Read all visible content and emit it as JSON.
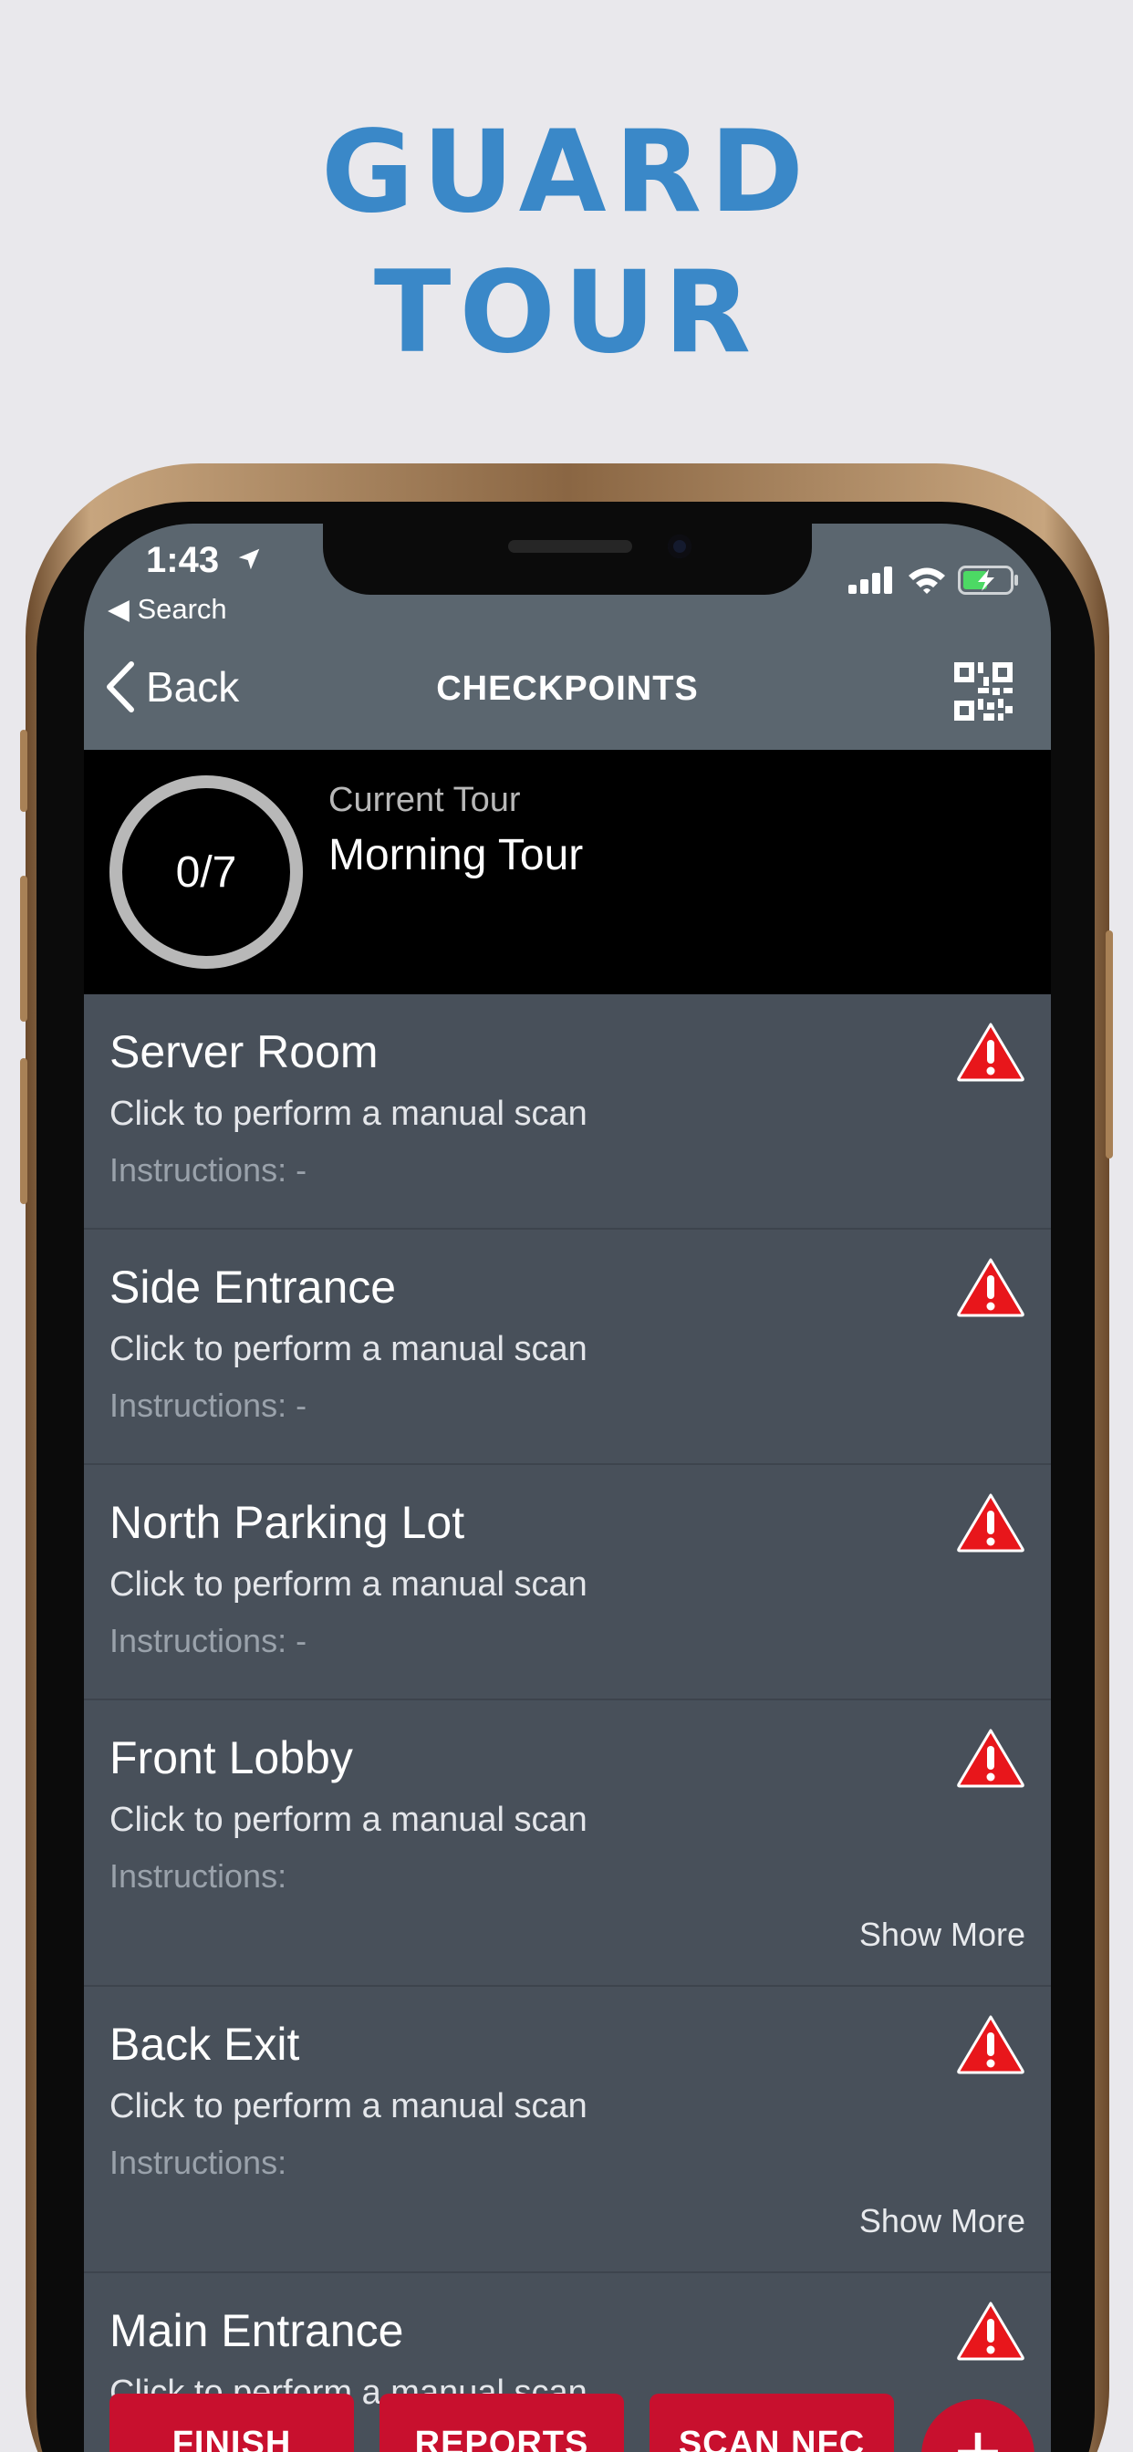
{
  "headline": {
    "line1": "GUARD",
    "line2": "TOUR"
  },
  "status_bar": {
    "time": "1:43",
    "back_app": "◀ Search"
  },
  "nav": {
    "back_label": "Back",
    "title": "CHECKPOINTS"
  },
  "tour": {
    "progress": "0/7",
    "current_label": "Current Tour",
    "name": "Morning Tour"
  },
  "checkpoints": [
    {
      "title": "Server Room",
      "subtitle": "Click to perform a manual scan",
      "instructions": "Instructions: -"
    },
    {
      "title": "Side Entrance",
      "subtitle": "Click to perform a manual scan",
      "instructions": "Instructions: -"
    },
    {
      "title": "North Parking Lot",
      "subtitle": "Click to perform a manual scan",
      "instructions": "Instructions: -"
    },
    {
      "title": "Front Lobby",
      "subtitle": "Click to perform a manual scan",
      "instructions": "Instructions:",
      "show_more": "Show More"
    },
    {
      "title": "Back Exit",
      "subtitle": "Click to perform a manual scan",
      "instructions": "Instructions:",
      "show_more": "Show More"
    },
    {
      "title": "Main Entrance",
      "subtitle": "Click to perform a manual scan"
    }
  ],
  "actions": {
    "finish": "FINISH",
    "reports": "REPORTS",
    "scan_nfc": "SCAN NFC",
    "add": "+"
  },
  "colors": {
    "headline": "#3a88c8",
    "nav_bar": "#5b666f",
    "list_bg": "#48505a",
    "accent_red": "#c8102e",
    "battery_green": "#4cd964"
  },
  "icons": [
    "location-arrow-icon",
    "signal-icon",
    "wifi-icon",
    "battery-charging-icon",
    "chevron-left-icon",
    "qr-code-icon",
    "warning-icon"
  ]
}
